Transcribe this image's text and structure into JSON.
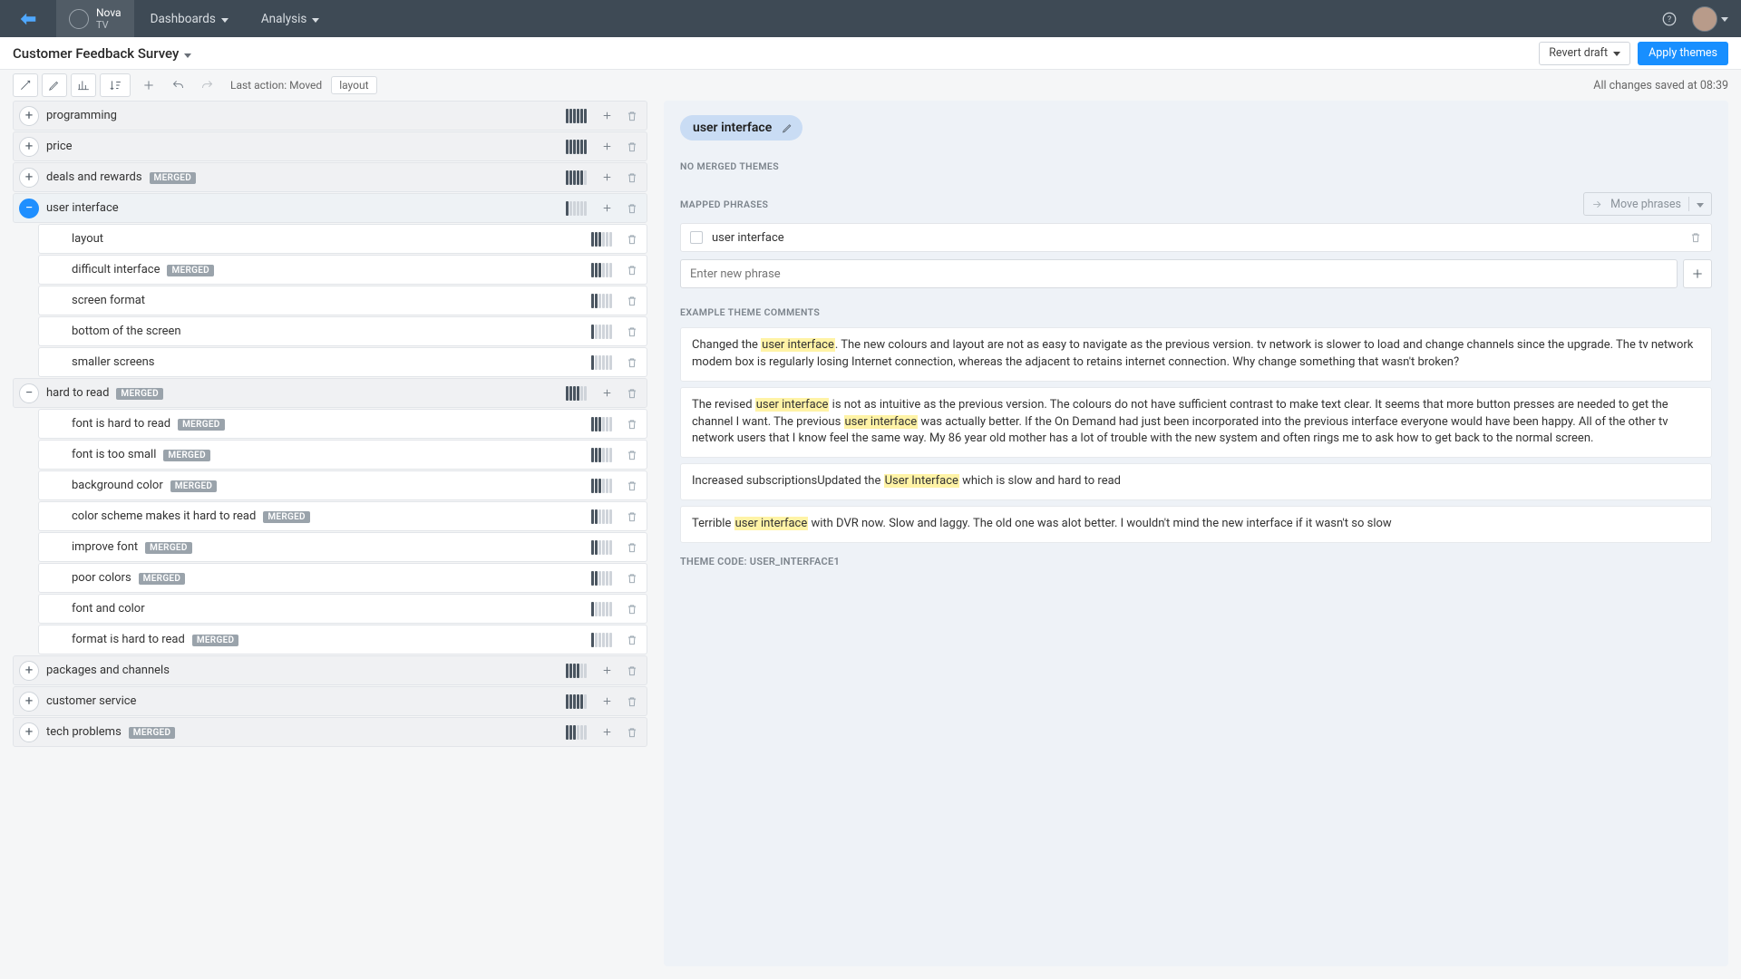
{
  "nav": {
    "brand_l1": "Nova",
    "brand_l2": "TV",
    "dashboards": "Dashboards",
    "analysis": "Analysis"
  },
  "sub": {
    "title": "Customer Feedback Survey",
    "revert": "Revert draft",
    "apply": "Apply themes"
  },
  "tb": {
    "last_label": "Last action: Moved",
    "last_chip": "layout",
    "saved": "All changes saved at 08:39"
  },
  "tree": [
    {
      "lvl": 0,
      "name": "programming",
      "bars": 6,
      "expand": "+",
      "add": true
    },
    {
      "lvl": 0,
      "name": "price",
      "bars": 6,
      "expand": "+",
      "add": true
    },
    {
      "lvl": 0,
      "name": "deals and rewards",
      "bars": 5,
      "expand": "+",
      "add": true,
      "merged": true
    },
    {
      "lvl": 0,
      "name": "user interface",
      "bars": 1,
      "expand": "-",
      "add": true,
      "selected": true,
      "active": true
    },
    {
      "lvl": 1,
      "name": "layout",
      "bars": 3
    },
    {
      "lvl": 1,
      "name": "difficult interface",
      "bars": 3,
      "merged": true
    },
    {
      "lvl": 1,
      "name": "screen format",
      "bars": 2
    },
    {
      "lvl": 1,
      "name": "bottom of the screen",
      "bars": 1
    },
    {
      "lvl": 1,
      "name": "smaller screens",
      "bars": 1
    },
    {
      "lvl": 0,
      "name": "hard to read",
      "bars": 4,
      "expand": "-",
      "add": true,
      "merged": true
    },
    {
      "lvl": 1,
      "name": "font is hard to read",
      "bars": 3,
      "merged": true
    },
    {
      "lvl": 1,
      "name": "font is too small",
      "bars": 3,
      "merged": true
    },
    {
      "lvl": 1,
      "name": "background color",
      "bars": 3,
      "merged": true
    },
    {
      "lvl": 1,
      "name": "color scheme makes it hard to read",
      "bars": 2,
      "merged": true
    },
    {
      "lvl": 1,
      "name": "improve font",
      "bars": 2,
      "merged": true
    },
    {
      "lvl": 1,
      "name": "poor colors",
      "bars": 2,
      "merged": true
    },
    {
      "lvl": 1,
      "name": "font and color",
      "bars": 1
    },
    {
      "lvl": 1,
      "name": "format is hard to read",
      "bars": 1,
      "merged": true
    },
    {
      "lvl": 0,
      "name": "packages and channels",
      "bars": 4,
      "expand": "+",
      "add": true
    },
    {
      "lvl": 0,
      "name": "customer service",
      "bars": 5,
      "expand": "+",
      "add": true
    },
    {
      "lvl": 0,
      "name": "tech problems",
      "bars": 3,
      "expand": "+",
      "add": true,
      "merged": true
    }
  ],
  "detail": {
    "chip": "user interface",
    "no_merged": "NO MERGED THEMES",
    "mapped_label": "MAPPED PHRASES",
    "move": "Move phrases",
    "phrase0": "user interface",
    "newphrase_ph": "Enter new phrase",
    "examples_label": "EXAMPLE THEME COMMENTS",
    "c1a": "Changed the ",
    "c1b": ". The new colours and layout are not as easy to navigate as the previous version. tv network is slower to load and change channels since the upgrade. The tv network modem box is regularly losing Internet connection, whereas the adjacent to retains internet connection. Why change something that wasn't broken?",
    "c2a": "The revised ",
    "c2b": " is not as intuitive as the previous version. The colours do not have sufficient contrast to make text clear. It seems that more button presses are needed to get the channel I want. The previous ",
    "c2c": " was actually better. If the On Demand had just been incorporated into the previous interface everyone would have been happy. All of the other tv network users that I know feel the same way. My 86 year old mother has a lot of trouble with the new system and often rings me to ask how to get back to the normal screen.",
    "c3a": "Increased subscriptionsUpdated the ",
    "c3b": " which is slow and hard to read",
    "c4a": "Terrible ",
    "c4b": " with DVR now. Slow and laggy. The old one was alot better. I wouldn't mind the new interface if it wasn't so slow",
    "hl1": "user interface",
    "hl2": "user interface",
    "hl3": "user interface",
    "hl4": "User Interface",
    "hl5": "user interface",
    "code_label": "THEME CODE: ",
    "code_value": "USER_INTERFACE1",
    "merged_badge": "MERGED"
  }
}
